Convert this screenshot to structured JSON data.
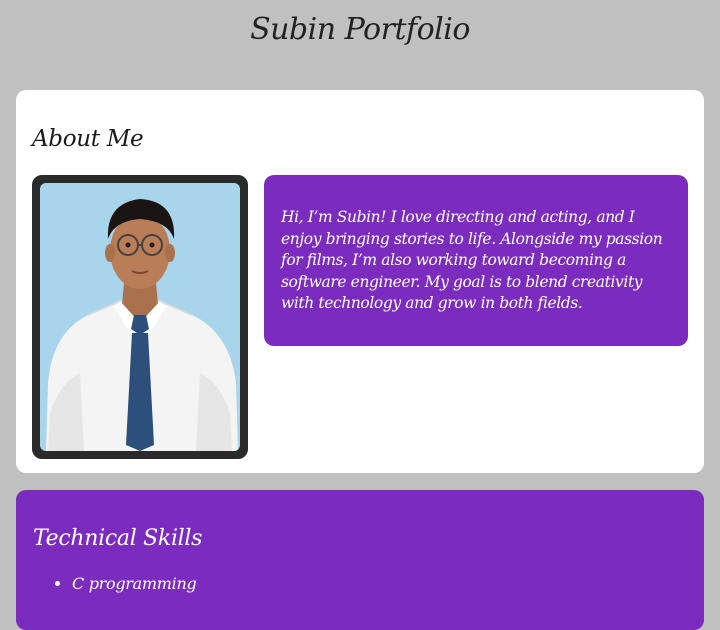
{
  "header": {
    "title": "Subin Portfolio"
  },
  "about": {
    "heading": "About Me",
    "photo_alt": "Portrait photo",
    "bio": "Hi, I’m Subin! I love directing and acting, and I enjoy bringing stories to life. Alongside my passion for films, I’m also working toward becoming a software engineer. My goal is to blend creativity with technology and grow in both fields."
  },
  "skills": {
    "heading": "Technical Skills",
    "items": [
      "C programming"
    ]
  },
  "colors": {
    "page_background": "#c0c0c0",
    "card_background": "#ffffff",
    "accent_purple": "#7b2cbf",
    "photo_frame": "#2a2a2a"
  }
}
